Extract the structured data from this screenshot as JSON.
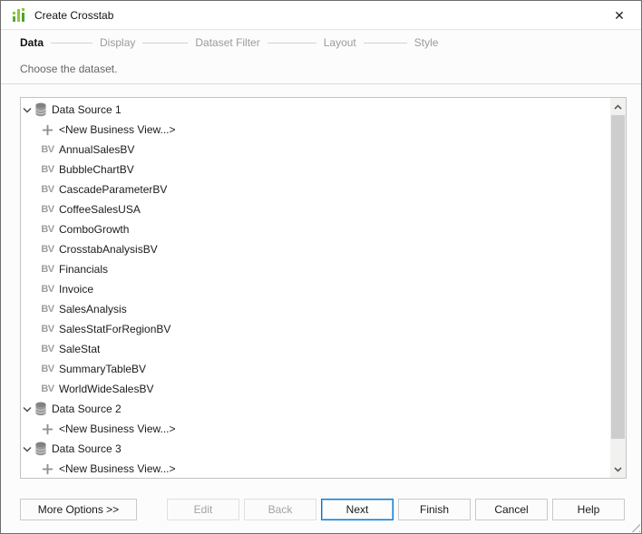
{
  "window": {
    "title": "Create Crosstab",
    "close_glyph": "✕"
  },
  "steps": {
    "items": [
      {
        "label": "Data",
        "active": true
      },
      {
        "label": "Display",
        "active": false
      },
      {
        "label": "Dataset Filter",
        "active": false
      },
      {
        "label": "Layout",
        "active": false
      },
      {
        "label": "Style",
        "active": false
      }
    ]
  },
  "instruction": "Choose the dataset.",
  "icons": {
    "bv": "BV"
  },
  "tree": {
    "datasources": [
      {
        "label": "Data Source 1",
        "expanded": true,
        "children": [
          {
            "kind": "new",
            "label": "<New Business View...>"
          },
          {
            "kind": "bv",
            "label": "AnnualSalesBV"
          },
          {
            "kind": "bv",
            "label": "BubbleChartBV"
          },
          {
            "kind": "bv",
            "label": "CascadeParameterBV"
          },
          {
            "kind": "bv",
            "label": "CoffeeSalesUSA"
          },
          {
            "kind": "bv",
            "label": "ComboGrowth"
          },
          {
            "kind": "bv",
            "label": "CrosstabAnalysisBV"
          },
          {
            "kind": "bv",
            "label": "Financials"
          },
          {
            "kind": "bv",
            "label": "Invoice"
          },
          {
            "kind": "bv",
            "label": "SalesAnalysis"
          },
          {
            "kind": "bv",
            "label": "SalesStatForRegionBV"
          },
          {
            "kind": "bv",
            "label": "SaleStat"
          },
          {
            "kind": "bv",
            "label": "SummaryTableBV"
          },
          {
            "kind": "bv",
            "label": "WorldWideSalesBV"
          }
        ]
      },
      {
        "label": "Data Source 2",
        "expanded": true,
        "children": [
          {
            "kind": "new",
            "label": "<New Business View...>"
          }
        ]
      },
      {
        "label": "Data Source 3",
        "expanded": true,
        "children": [
          {
            "kind": "new",
            "label": "<New Business View...>"
          }
        ]
      }
    ]
  },
  "footer": {
    "buttons": [
      {
        "label": "More Options >>",
        "enabled": true,
        "default": false
      },
      {
        "label": "Edit",
        "enabled": false,
        "default": false
      },
      {
        "label": "Back",
        "enabled": false,
        "default": false
      },
      {
        "label": "Next",
        "enabled": true,
        "default": true
      },
      {
        "label": "Finish",
        "enabled": true,
        "default": false
      },
      {
        "label": "Cancel",
        "enabled": true,
        "default": false
      },
      {
        "label": "Help",
        "enabled": true,
        "default": false
      }
    ]
  },
  "colors": {
    "accent_blue": "#0078d7",
    "icon_green_light": "#8dc63f",
    "icon_green_dark": "#4da32f",
    "icon_gray": "#8f8f8f"
  }
}
